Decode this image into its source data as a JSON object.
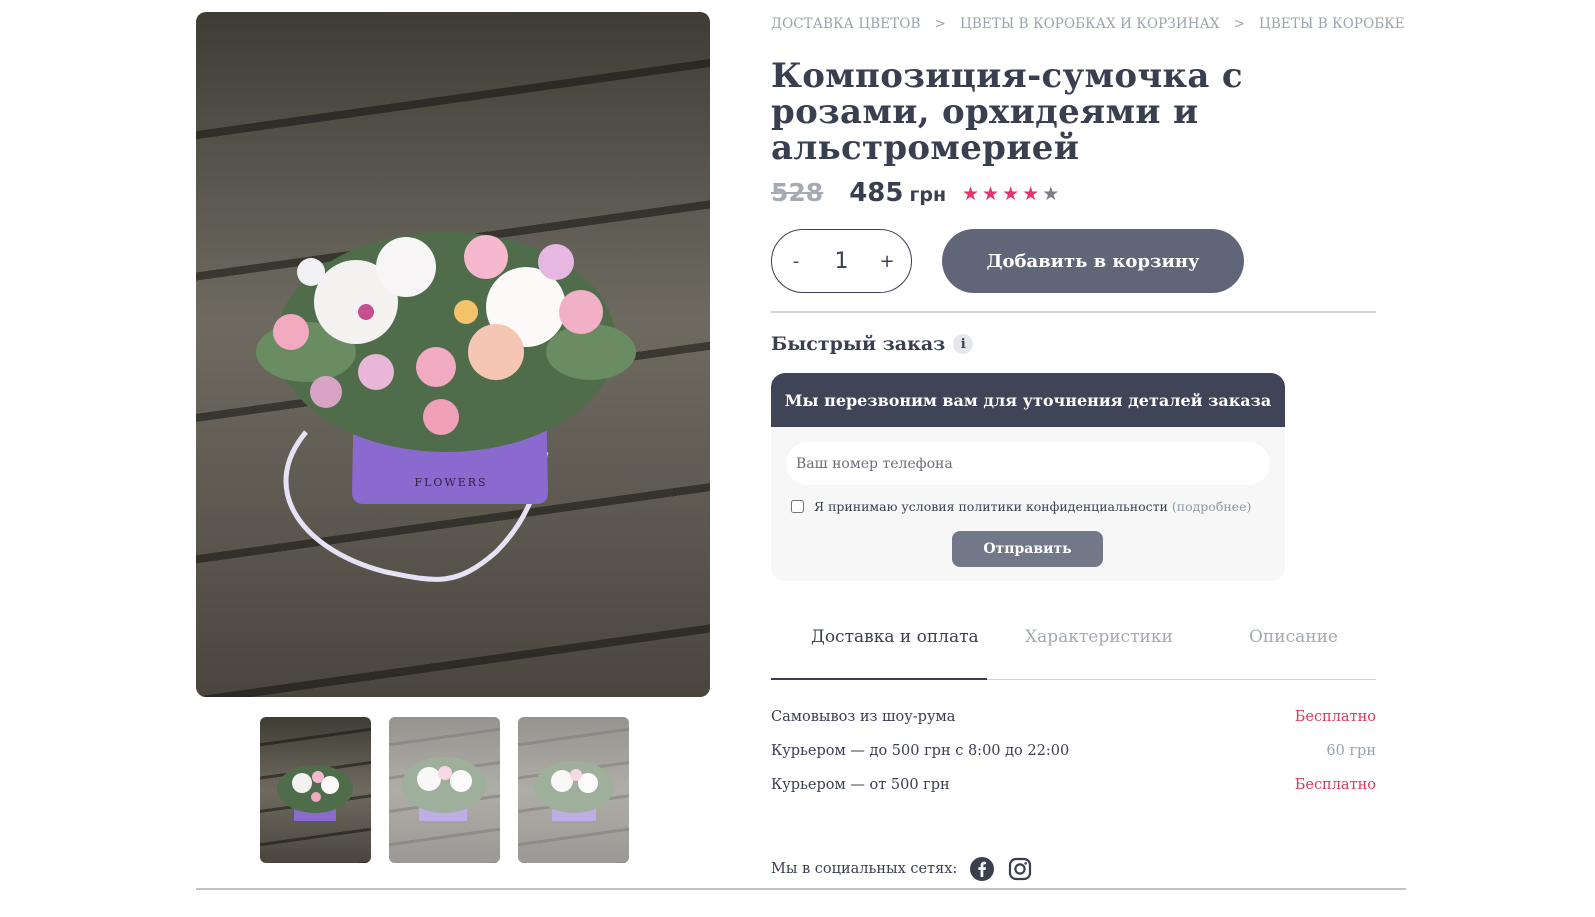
{
  "breadcrumb": [
    {
      "label": "ДОСТАВКА ЦВЕТОВ"
    },
    {
      "label": "ЦВЕТЫ В КОРОБКАХ И КОРЗИНАХ"
    },
    {
      "label": "ЦВЕТЫ В КОРОБКЕ"
    }
  ],
  "breadcrumb_separator": ">",
  "product": {
    "title": "Композиция-сумочка с розами, орхидеями и альстромерией",
    "old_price": "528",
    "price": "485",
    "currency": "грн",
    "rating": 4,
    "rating_max": 5,
    "box_text": "FLOWERS"
  },
  "quantity": {
    "minus": "-",
    "value": "1",
    "plus": "+"
  },
  "cart": {
    "add_label": "Добавить в корзину"
  },
  "quick_order": {
    "title": "Быстрый заказ",
    "info": "i",
    "banner": "Мы перезвоним вам для уточнения деталей заказа",
    "phone_placeholder": "Ваш номер телефона",
    "consent": "Я принимаю условия политики конфиденциальности",
    "more": "(подробнее)",
    "submit": "Отправить"
  },
  "tabs": [
    {
      "label": "Доставка и оплата",
      "active": true
    },
    {
      "label": "Характеристики",
      "active": false
    },
    {
      "label": "Описание",
      "active": false
    }
  ],
  "delivery": [
    {
      "method": "Самовывоз из шоу-рума",
      "price": "Бесплатно",
      "free": true
    },
    {
      "method": "Курьером — до 500 грн с 8:00 до 22:00",
      "price": "60 грн",
      "free": false
    },
    {
      "method": "Курьером — от 500 грн",
      "price": "Бесплатно",
      "free": true
    }
  ],
  "social": {
    "label": "Мы в социальных сетях:",
    "icons": [
      "facebook-icon",
      "instagram-icon"
    ]
  },
  "colors": {
    "accent": "#e8336b",
    "dark": "#3f4457",
    "button": "#606678",
    "free_price": "#d63a5c"
  }
}
